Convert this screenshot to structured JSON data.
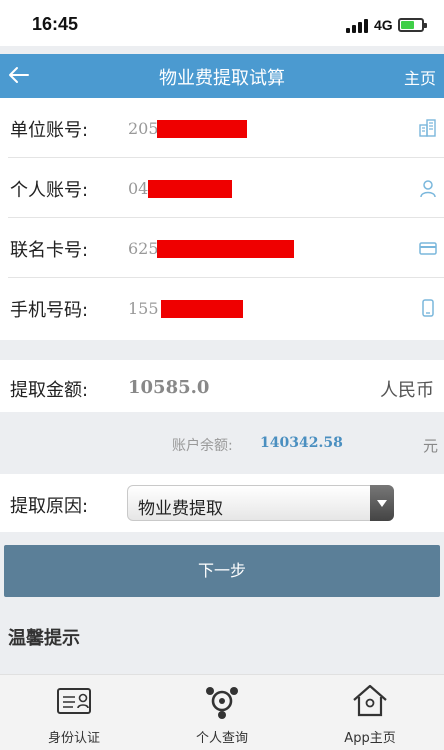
{
  "status": {
    "time": "16:45",
    "network": "4G"
  },
  "nav": {
    "title": "物业费提取试算",
    "home": "主页"
  },
  "form": {
    "rows": [
      {
        "label": "单位账号:",
        "value": "205"
      },
      {
        "label": "个人账号:",
        "value": "04"
      },
      {
        "label": "联名卡号:",
        "value": "625"
      },
      {
        "label": "手机号码:",
        "value": "155"
      }
    ]
  },
  "amount": {
    "label": "提取金额:",
    "value": "10585.0",
    "unit": "人民币"
  },
  "balance": {
    "label": "账户余额:",
    "value": "140342.58",
    "unit": "元"
  },
  "reason": {
    "label": "提取原因:",
    "selected": "物业费提取"
  },
  "next_button": "下一步",
  "tips_title": "温馨提示",
  "tabbar": {
    "items": [
      {
        "label": "身份认证",
        "icon": "id-card-icon"
      },
      {
        "label": "个人查询",
        "icon": "person-query-icon"
      },
      {
        "label": "App主页",
        "icon": "home-icon"
      }
    ]
  },
  "colors": {
    "nav": "#4b9ad0",
    "button": "#5b7f98",
    "accent": "#4a8fc0",
    "redaction": "#ef0000"
  }
}
